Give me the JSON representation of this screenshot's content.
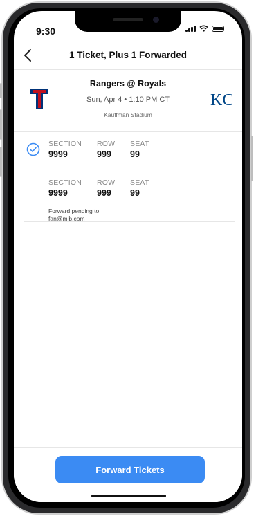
{
  "status_bar": {
    "time": "9:30"
  },
  "nav": {
    "title": "1 Ticket, Plus 1 Forwarded"
  },
  "event": {
    "title": "Rangers @ Royals",
    "date": "Sun, Apr 4 • 1:10 PM CT",
    "venue": "Kauffman Stadium",
    "home_logo_text": "KC",
    "away_logo_text": "T"
  },
  "tickets": [
    {
      "section_label": "SECTION",
      "section": "9999",
      "row_label": "ROW",
      "row": "999",
      "seat_label": "SEAT",
      "seat": "99",
      "selected": true
    },
    {
      "section_label": "SECTION",
      "section": "9999",
      "row_label": "ROW",
      "row": "999",
      "seat_label": "SEAT",
      "seat": "99",
      "selected": false,
      "note": "Forward pending to fan@mlb.com"
    }
  ],
  "footer": {
    "button_label": "Forward Tickets"
  },
  "colors": {
    "accent": "#3b8bf3",
    "rangers_red": "#c0111f",
    "rangers_blue": "#003278",
    "royals_blue": "#004687"
  }
}
